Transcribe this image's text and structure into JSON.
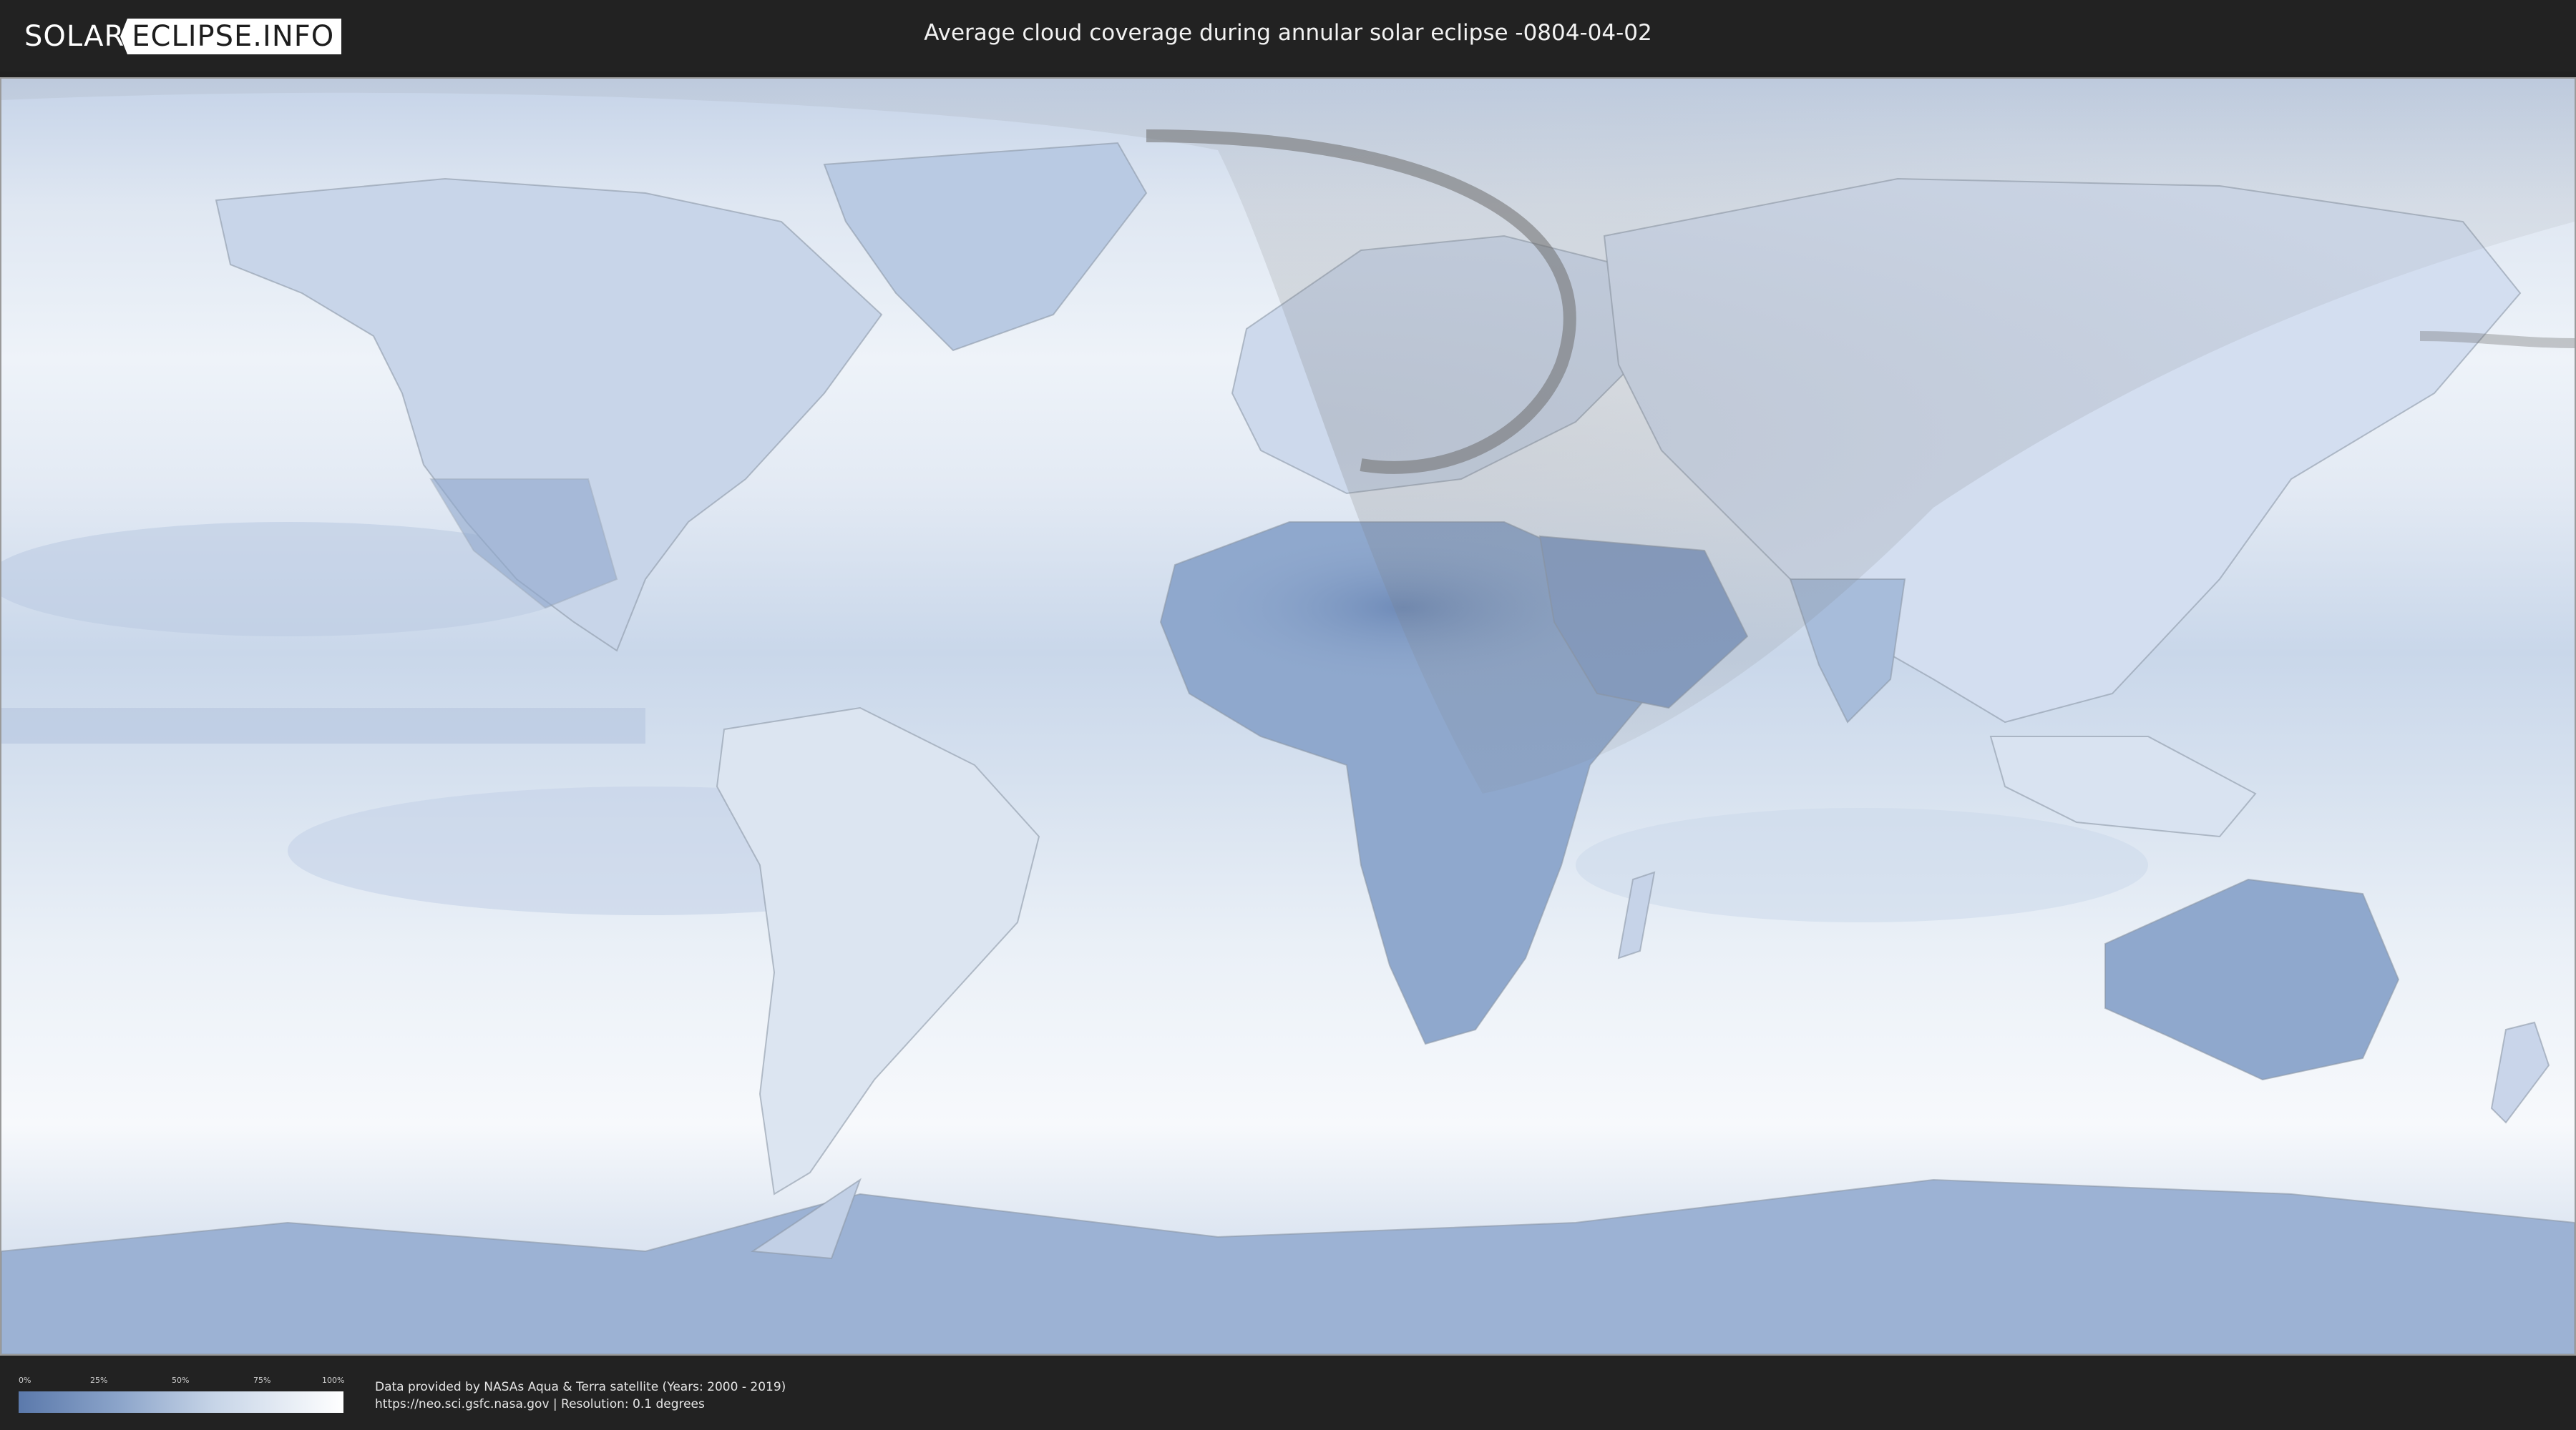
{
  "header": {
    "logo_left": "SOLAR",
    "logo_right": "ECLIPSE.INFO",
    "title": "Average cloud coverage during annular solar eclipse -0804-04-02"
  },
  "legend": {
    "ticks": [
      "0%",
      "25%",
      "50%",
      "75%",
      "100%"
    ],
    "gradient_colors": [
      "#5b79ab",
      "#8aa3c9",
      "#c6d4e7",
      "#ffffff"
    ]
  },
  "credits": {
    "line1": "Data provided by NASAs Aqua & Terra satellite (Years: 2000 - 2019)",
    "line2": "https://neo.sci.gsfc.nasa.gov | Resolution: 0.1 degrees"
  },
  "colors": {
    "header_bg": "#222222",
    "cloud_clear": "#5b79ab",
    "cloud_full": "#ffffff",
    "eclipse_shadow": "#7a7a7a"
  }
}
